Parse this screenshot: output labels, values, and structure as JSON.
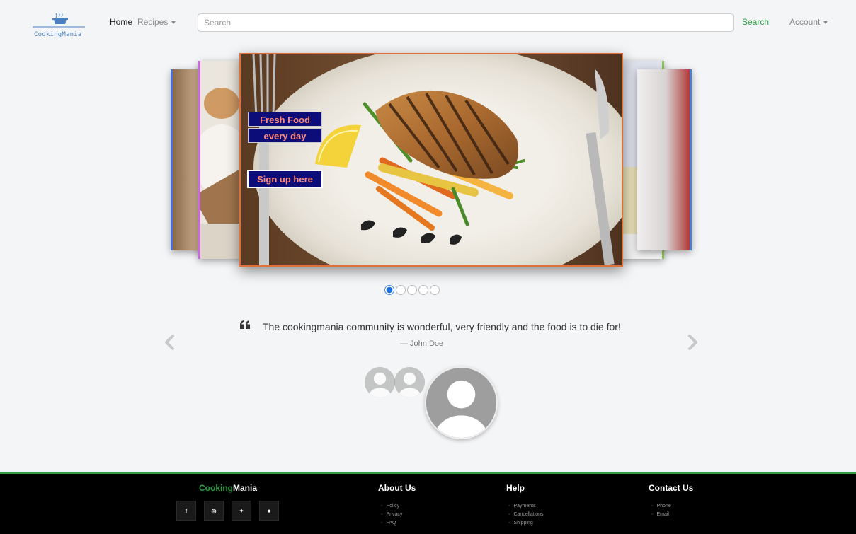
{
  "navbar": {
    "logo_text": "CookingMania",
    "home": "Home",
    "recipes": "Recipes",
    "search_placeholder": "Search",
    "search_button": "Search",
    "account": "Account"
  },
  "carousel": {
    "promo_line1": "Fresh Food",
    "promo_line2": "every day",
    "signup": "Sign up here",
    "slide_count": 5,
    "active_slide": 1
  },
  "testimonial": {
    "quote": "The cookingmania community is wonderful, very friendly and the food is to die for!",
    "author": "— John Doe"
  },
  "footer": {
    "brand_part1": "Cooking",
    "brand_part2": "Mania",
    "social": [
      "facebook",
      "instagram",
      "twitter",
      "youtube"
    ],
    "columns": [
      {
        "title": "About Us",
        "links": [
          "Policy",
          "Privacy",
          "FAQ"
        ]
      },
      {
        "title": "Help",
        "links": [
          "Payments",
          "Cancellations",
          "Shipping"
        ]
      },
      {
        "title": "Contact Us",
        "links": [
          "Phone",
          "Email"
        ]
      }
    ]
  },
  "colors": {
    "accent_green": "#2e9e44",
    "promo_bg": "#0d0d7a",
    "promo_text": "#ff8a7a"
  }
}
